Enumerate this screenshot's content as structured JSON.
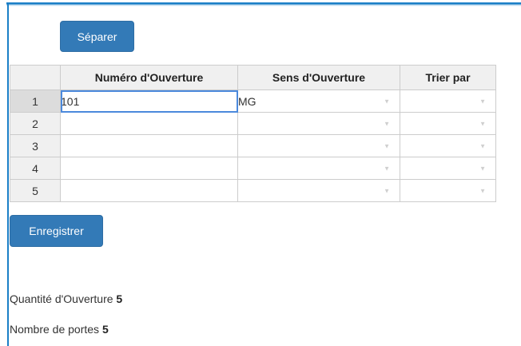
{
  "buttons": {
    "separate_label": "Séparer",
    "save_label": "Enregistrer"
  },
  "grid": {
    "columns": [
      "Numéro d'Ouverture",
      "Sens d'Ouverture",
      "Trier par"
    ],
    "rows": [
      {
        "num": "1",
        "opening_number": "101",
        "opening_direction": "MG",
        "sort_by": ""
      },
      {
        "num": "2",
        "opening_number": "",
        "opening_direction": "",
        "sort_by": ""
      },
      {
        "num": "3",
        "opening_number": "",
        "opening_direction": "",
        "sort_by": ""
      },
      {
        "num": "4",
        "opening_number": "",
        "opening_direction": "",
        "sort_by": ""
      },
      {
        "num": "5",
        "opening_number": "",
        "opening_direction": "",
        "sort_by": ""
      }
    ],
    "dropdown_icon": "triangle-down-icon"
  },
  "summary": {
    "opening_quantity_label": "Quantité d'Ouverture",
    "opening_quantity_value": "5",
    "door_count_label": "Nombre de portes",
    "door_count_value": "5"
  },
  "colors": {
    "button_bg": "#337ab7",
    "selection_border": "#4b89dc",
    "frame_accent": "#1b7fc7"
  }
}
